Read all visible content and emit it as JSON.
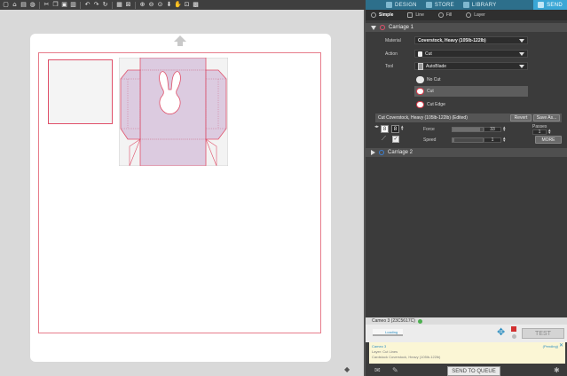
{
  "toolbar": {
    "icons": [
      "new-icon",
      "open-icon",
      "save-icon",
      "library-icon",
      "cut-icon",
      "copy-icon",
      "paste-icon",
      "delete-icon",
      "undo-icon",
      "redo-icon",
      "refresh-icon",
      "group-icon",
      "ungroup-icon",
      "zoom-in-icon",
      "zoom-out-icon",
      "zoom-fit-icon",
      "move-down-icon",
      "pan-icon",
      "fill-page-icon",
      "grid-icon"
    ]
  },
  "topnav": {
    "tabs": [
      {
        "label": "DESIGN"
      },
      {
        "label": "STORE"
      },
      {
        "label": "LIBRARY"
      },
      {
        "label": "SEND"
      }
    ]
  },
  "panel": {
    "subtabs": [
      {
        "label": "Simple"
      },
      {
        "label": "Line"
      },
      {
        "label": "Fill"
      },
      {
        "label": "Layer"
      }
    ],
    "carriage1": {
      "title": "Carriage 1",
      "material_label": "Material",
      "material_value": "Coverstock, Heavy (105lb-122lb)",
      "action_label": "Action",
      "action_value": "Cut",
      "tool_label": "Tool",
      "tool_value": "AutoBlade",
      "options": [
        "No Cut",
        "Cut",
        "Cut Edge"
      ],
      "edited_label": "Cut Coverstock, Heavy (105lb-122lb) (Edited)",
      "revert_label": "Revert",
      "save_as_label": "Save As...",
      "blade_value": "8",
      "force_label": "Force",
      "force_value": "33",
      "force_level": 0.9,
      "speed_label": "Speed",
      "speed_value": "1",
      "speed_level": 0.05,
      "passes_label": "Passes",
      "passes_value": "1",
      "more_label": "MORE"
    },
    "carriage2": {
      "title": "Carriage 2"
    },
    "device": {
      "name": "Cameo 3 (23C5617C)",
      "loading_label": "Loading",
      "test_label": "TEST"
    },
    "queue": {
      "line1": "Cameo 3",
      "line2": "Layer: Cut Lines",
      "line3": "Cardstock Coverstock, Heavy (105lb-122lb)",
      "status": "(Pending)",
      "close": "✕"
    },
    "send_label": "SEND TO QUEUE"
  },
  "colors": {
    "nav_bg": "#2d6f8b",
    "send_active": "#3aa7d6",
    "cut_line": "#e0506a",
    "template_fill": "#dccbe0"
  }
}
